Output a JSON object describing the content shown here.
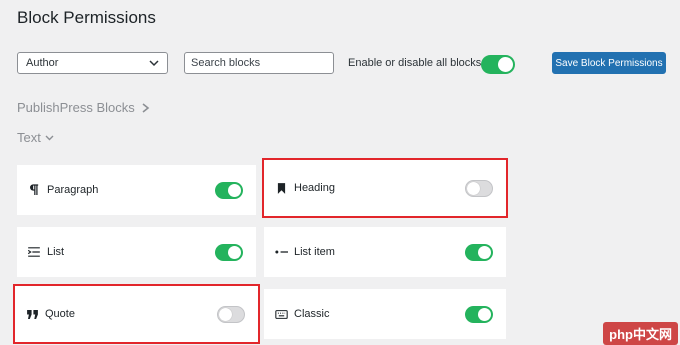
{
  "page": {
    "title": "Block Permissions"
  },
  "toolbar": {
    "role_value": "Author",
    "search_placeholder": "Search blocks",
    "toggle_all_label": "Enable or disable all blocks",
    "toggle_all_enabled": true,
    "save_label": "Save Block Permissions"
  },
  "breadcrumb": {
    "label": "PublishPress Blocks"
  },
  "category": {
    "label": "Text"
  },
  "blocks": [
    {
      "label": "Paragraph",
      "icon": "paragraph-icon",
      "enabled": true
    },
    {
      "label": "Heading",
      "icon": "bookmark-icon",
      "enabled": false
    },
    {
      "label": "List",
      "icon": "list-icon",
      "enabled": true
    },
    {
      "label": "List item",
      "icon": "list-item-icon",
      "enabled": true
    },
    {
      "label": "Quote",
      "icon": "quote-icon",
      "enabled": false
    },
    {
      "label": "Classic",
      "icon": "keyboard-icon",
      "enabled": true
    }
  ],
  "watermark": {
    "text": "php中文网"
  },
  "colors": {
    "accent": "#2271b1",
    "toggle_on": "#24b35d",
    "highlight": "#e2262b"
  }
}
